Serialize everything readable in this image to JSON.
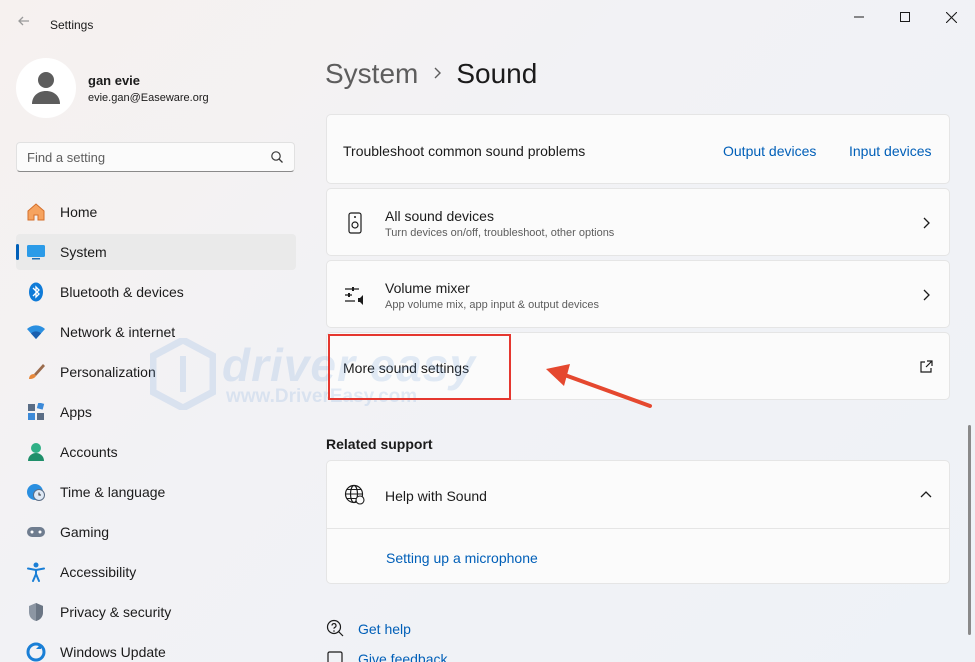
{
  "window": {
    "app_title": "Settings",
    "back_icon": "back-arrow-icon"
  },
  "user": {
    "name": "gan evie",
    "email": "evie.gan@Easeware.org"
  },
  "search": {
    "placeholder": "Find a setting"
  },
  "nav": {
    "items": [
      {
        "label": "Home",
        "icon": "home-icon"
      },
      {
        "label": "System",
        "icon": "system-icon",
        "active": true
      },
      {
        "label": "Bluetooth & devices",
        "icon": "bluetooth-icon"
      },
      {
        "label": "Network & internet",
        "icon": "wifi-icon"
      },
      {
        "label": "Personalization",
        "icon": "brush-icon"
      },
      {
        "label": "Apps",
        "icon": "apps-icon"
      },
      {
        "label": "Accounts",
        "icon": "accounts-icon"
      },
      {
        "label": "Time & language",
        "icon": "globe-clock-icon"
      },
      {
        "label": "Gaming",
        "icon": "gamepad-icon"
      },
      {
        "label": "Accessibility",
        "icon": "accessibility-icon"
      },
      {
        "label": "Privacy & security",
        "icon": "shield-icon"
      },
      {
        "label": "Windows Update",
        "icon": "update-icon"
      }
    ]
  },
  "breadcrumb": {
    "parent": "System",
    "separator": ">",
    "current": "Sound"
  },
  "troubleshoot": {
    "label": "Troubleshoot common sound problems",
    "output_link": "Output devices",
    "input_link": "Input devices"
  },
  "all_sound_devices": {
    "title": "All sound devices",
    "subtitle": "Turn devices on/off, troubleshoot, other options"
  },
  "volume_mixer": {
    "title": "Volume mixer",
    "subtitle": "App volume mix, app input & output devices"
  },
  "more_sound_settings": {
    "title": "More sound settings"
  },
  "related_support": {
    "heading": "Related support",
    "help_title": "Help with Sound",
    "link_microphone": "Setting up a microphone"
  },
  "footer_links": {
    "get_help": "Get help",
    "give_feedback": "Give feedback"
  },
  "watermark": {
    "brand": "driver easy",
    "url": "www.DriverEasy.com"
  },
  "colors": {
    "accent": "#005fb8",
    "highlight": "#e5372f"
  }
}
